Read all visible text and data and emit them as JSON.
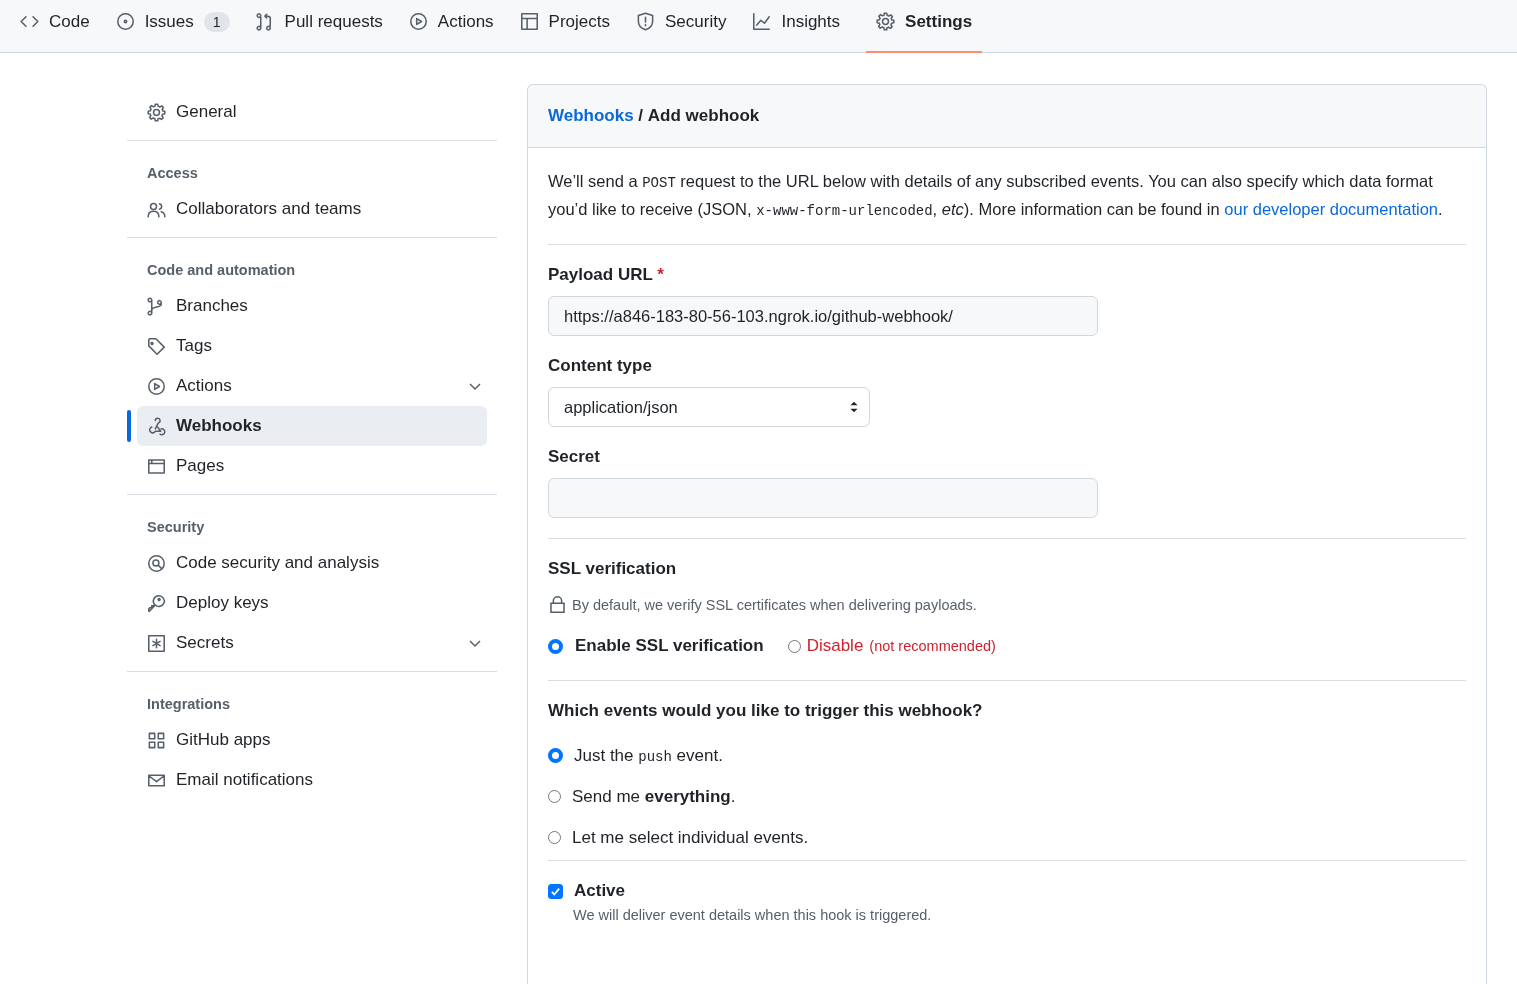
{
  "repo_nav": [
    {
      "label": "Code",
      "selected": false
    },
    {
      "label": "Issues",
      "count": "1",
      "selected": false
    },
    {
      "label": "Pull requests",
      "selected": false
    },
    {
      "label": "Actions",
      "selected": false
    },
    {
      "label": "Projects",
      "selected": false
    },
    {
      "label": "Security",
      "selected": false
    },
    {
      "label": "Insights",
      "selected": false
    },
    {
      "label": "Settings",
      "selected": true
    }
  ],
  "sidebar": {
    "groups": [
      {
        "items": [
          {
            "label": "General",
            "kind": "link",
            "selected": false
          }
        ]
      },
      {
        "heading": "Access",
        "items": [
          {
            "label": "Collaborators and teams",
            "kind": "link",
            "selected": false
          }
        ]
      },
      {
        "heading": "Code and automation",
        "items": [
          {
            "label": "Branches",
            "kind": "link",
            "selected": false
          },
          {
            "label": "Tags",
            "kind": "link",
            "selected": false
          },
          {
            "label": "Actions",
            "kind": "menu",
            "selected": false
          },
          {
            "label": "Webhooks",
            "kind": "link",
            "selected": true
          },
          {
            "label": "Pages",
            "kind": "link",
            "selected": false
          }
        ]
      },
      {
        "heading": "Security",
        "items": [
          {
            "label": "Code security and analysis",
            "kind": "link",
            "selected": false
          },
          {
            "label": "Deploy keys",
            "kind": "link",
            "selected": false
          },
          {
            "label": "Secrets",
            "kind": "menu",
            "selected": false
          }
        ]
      },
      {
        "heading": "Integrations",
        "items": [
          {
            "label": "GitHub apps",
            "kind": "link",
            "selected": false
          },
          {
            "label": "Email notifications",
            "kind": "link",
            "selected": false
          }
        ]
      }
    ]
  },
  "breadcrumb": {
    "parent": "Webhooks",
    "separator": "/",
    "current": "Add webhook"
  },
  "intro": [
    {
      "kind": "text",
      "text": "We’ll send a "
    },
    {
      "kind": "code",
      "text": "POST"
    },
    {
      "kind": "text",
      "text": " request to the URL below with details of any subscribed events. You can also specify which data format you’d like to receive (JSON, "
    },
    {
      "kind": "code",
      "text": "x-www-form-urlencoded"
    },
    {
      "kind": "text",
      "text": ", *etc*). More information can be found in "
    },
    {
      "kind": "link",
      "text": "our developer documentation"
    },
    {
      "kind": "text",
      "text": "."
    }
  ],
  "payload_url": {
    "label": "Payload URL",
    "required_mark": "*",
    "value": "https://a846-183-80-56-103.ngrok.io/github-webhook/"
  },
  "content_type": {
    "label": "Content type",
    "value": "application/json"
  },
  "secret": {
    "label": "Secret"
  },
  "ssl": {
    "heading": "SSL verification",
    "note": "By default, we verify SSL certificates when delivering payloads.",
    "options": [
      {
        "label": "Enable SSL verification",
        "kind": "normal",
        "selected": true
      },
      {
        "label": "Disable",
        "hint": "(not recommended)",
        "kind": "danger",
        "selected": false
      }
    ]
  },
  "events": {
    "heading": "Which events would you like to trigger this webhook?",
    "options": [
      {
        "parts": [
          {
            "kind": "text",
            "text": "Just the "
          },
          {
            "kind": "code",
            "text": "push"
          },
          {
            "kind": "text",
            "text": " event."
          }
        ],
        "selected": true
      },
      {
        "parts": [
          {
            "kind": "text",
            "text": "Send me **everything**."
          }
        ],
        "selected": false
      },
      {
        "parts": [
          {
            "kind": "text",
            "text": "Let me select individual events."
          }
        ],
        "selected": false
      }
    ]
  },
  "active": {
    "label": "Active",
    "checked": true,
    "description": "We will deliver event details when this hook is triggered."
  }
}
